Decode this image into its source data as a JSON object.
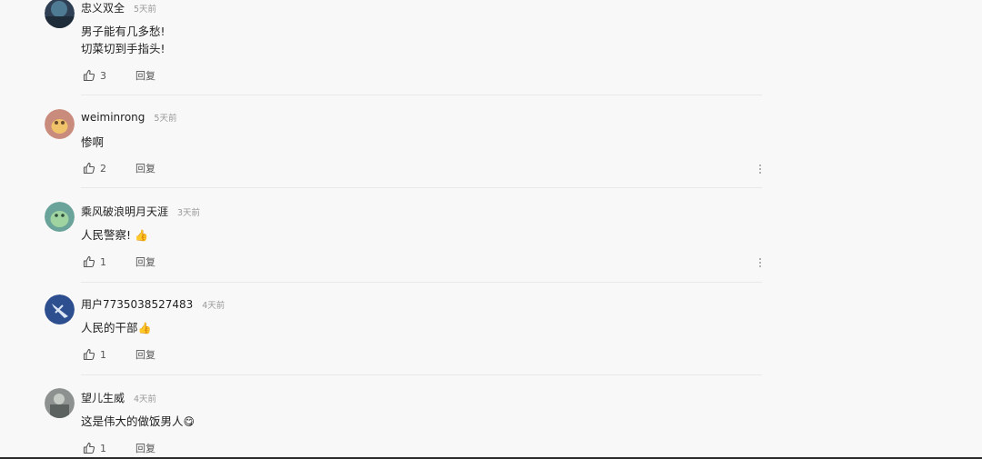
{
  "comments": [
    {
      "username": "忠义双全",
      "time": "5天前",
      "lines": [
        "男子能有几多愁!",
        "切菜切到手指头!"
      ],
      "likes": "3",
      "reply_label": "回复"
    },
    {
      "username": "weiminrong",
      "time": "5天前",
      "lines": [
        "惨啊"
      ],
      "likes": "2",
      "reply_label": "回复"
    },
    {
      "username": "乘风破浪明月天涯",
      "time": "3天前",
      "lines": [
        "人民警察!"
      ],
      "emoji": "👍",
      "likes": "1",
      "reply_label": "回复"
    },
    {
      "username": "用户7735038527483",
      "time": "4天前",
      "lines": [
        "人民的干部"
      ],
      "emoji": "👍",
      "likes": "1",
      "reply_label": "回复"
    },
    {
      "username": "望儿生威",
      "time": "4天前",
      "lines": [
        "这是伟大的做饭男人"
      ],
      "emoji": "😋",
      "likes": "1",
      "reply_label": "回复"
    }
  ],
  "icons": {
    "like": "thumbs-up-outline-icon",
    "more": "vertical-ellipsis-icon"
  },
  "colors": {
    "background": "#f8f8f8",
    "text": "#222222",
    "muted": "#999999",
    "divider": "#e8e8e8"
  }
}
